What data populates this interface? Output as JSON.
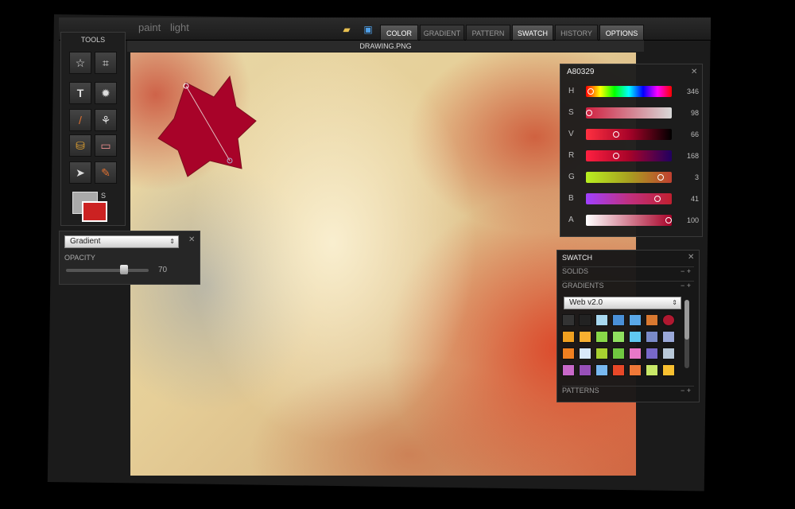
{
  "app": {
    "brand_paint": "paint",
    "brand_light": "light"
  },
  "toolbar": {
    "open_icon": "folder-icon",
    "save_icon": "floppy-disk-icon",
    "tabs": [
      {
        "label": "COLOR",
        "active": true
      },
      {
        "label": "GRADIENT",
        "active": false
      },
      {
        "label": "PATTERN",
        "active": false
      },
      {
        "label": "SWATCH",
        "active": true
      },
      {
        "label": "HISTORY",
        "active": false
      },
      {
        "label": "OPTIONS",
        "active": true
      }
    ]
  },
  "document": {
    "title": "DRAWING.PNG",
    "shape_color": "#A80329"
  },
  "tools": {
    "title": "TOOLS",
    "items": [
      {
        "name": "star-shape-tool",
        "icon": "☆"
      },
      {
        "name": "crop-tool",
        "icon": "⌗"
      },
      {
        "name": "text-tool",
        "icon": "T"
      },
      {
        "name": "settings-tool",
        "icon": "✹"
      },
      {
        "name": "brush-tool",
        "icon": "/"
      },
      {
        "name": "stamp-tool",
        "icon": "⚘"
      },
      {
        "name": "fill-bucket-tool",
        "icon": "⛁"
      },
      {
        "name": "eraser-tool",
        "icon": "▭"
      },
      {
        "name": "select-arrow-tool",
        "icon": "➤"
      },
      {
        "name": "eyedropper-tool",
        "icon": "✎"
      }
    ],
    "swap_label": "S"
  },
  "options": {
    "fill_select": "Gradient",
    "opacity_label": "OPACITY",
    "opacity_value": "70",
    "opacity_fraction": 0.7
  },
  "color": {
    "hex": "A80329",
    "channels": [
      {
        "label": "H",
        "value": "346",
        "pos": 0.02
      },
      {
        "label": "S",
        "value": "98",
        "pos": 0.0
      },
      {
        "label": "V",
        "value": "66",
        "pos": 0.34
      },
      {
        "label": "R",
        "value": "168",
        "pos": 0.34
      },
      {
        "label": "G",
        "value": "3",
        "pos": 0.9
      },
      {
        "label": "B",
        "value": "41",
        "pos": 0.86
      },
      {
        "label": "A",
        "value": "100",
        "pos": 1.0
      }
    ]
  },
  "swatch": {
    "title": "SWATCH",
    "solids": "SOLIDS",
    "gradients": "GRADIENTS",
    "patterns": "PATTERNS",
    "set_select": "Web v2.0",
    "colors": [
      "#333333",
      "#222222",
      "#a8d8f0",
      "#4a90d8",
      "#5aa8e8",
      "#d87830",
      "#b01830",
      "#f0a020",
      "#f8b030",
      "#88d848",
      "#90e060",
      "#60c8f0",
      "#7a8ac8",
      "#9aa8d8",
      "#f08020",
      "#d8e8f8",
      "#a8d030",
      "#70c840",
      "#e878c8",
      "#7868c8",
      "#b8c8d8",
      "#c868c8",
      "#9850b8",
      "#78b8f0",
      "#e84828",
      "#f07838",
      "#c8e868",
      "#f8c030"
    ]
  }
}
